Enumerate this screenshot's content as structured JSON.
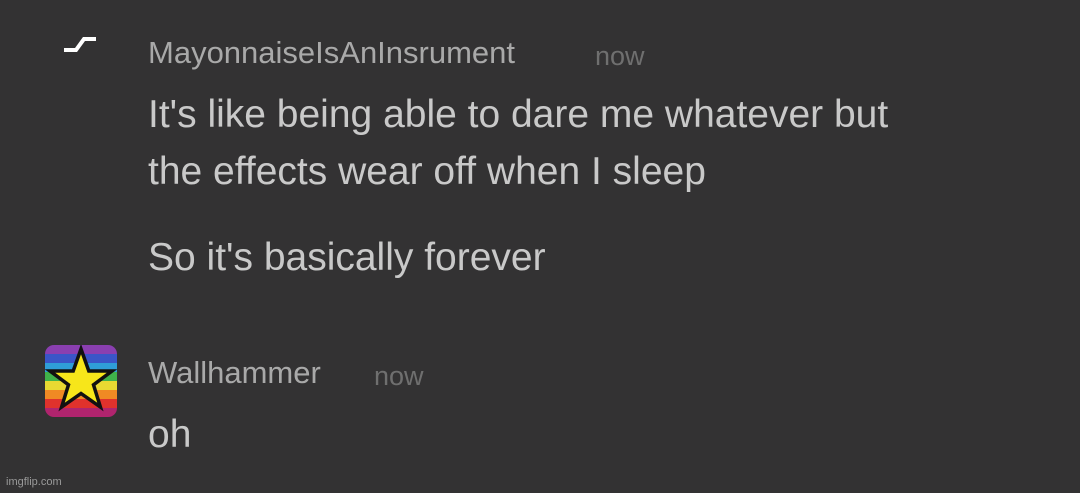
{
  "messages": [
    {
      "avatar_icon": "lightning-bolt-icon",
      "username": "MayonnaiseIsAnInsrument",
      "timestamp": "now",
      "lines": [
        "It's like being able to dare me whatever but",
        "the effects wear off when I sleep",
        "So it's basically forever"
      ]
    },
    {
      "avatar_icon": "rainbow-star-icon",
      "username": "Wallhammer",
      "timestamp": "now",
      "lines": [
        "oh"
      ]
    }
  ],
  "watermark": "imgflip.com",
  "colors": {
    "background": "#333233",
    "username": "#a9a9a9",
    "timestamp": "#6f6f6f",
    "message": "#c9c9c9",
    "star": "#f7e61a"
  }
}
